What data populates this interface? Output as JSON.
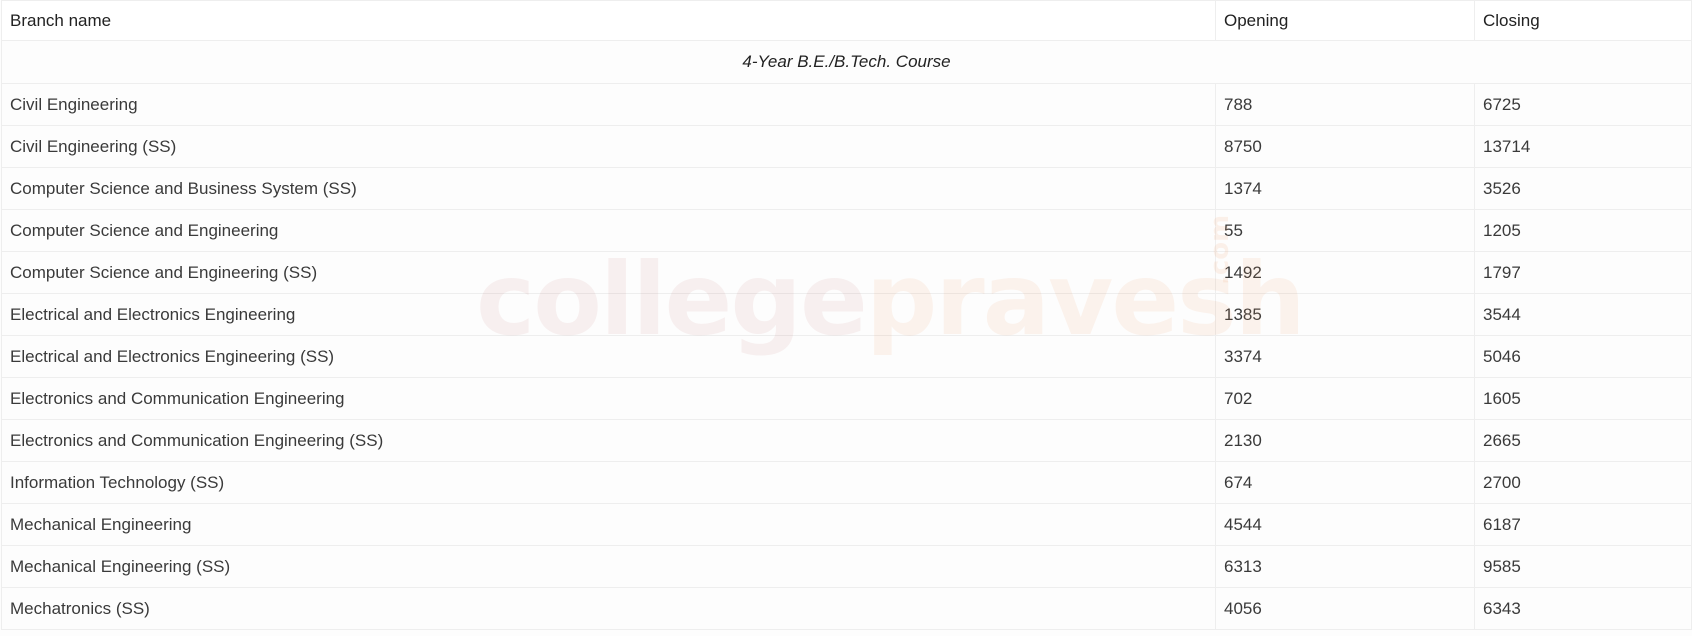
{
  "table": {
    "headers": [
      "Branch name",
      "Opening",
      "Closing"
    ],
    "section_label": "4-Year B.E./B.Tech. Course",
    "rows": [
      {
        "branch": "Civil Engineering",
        "opening": "788",
        "closing": "6725"
      },
      {
        "branch": "Civil Engineering (SS)",
        "opening": "8750",
        "closing": "13714"
      },
      {
        "branch": "Computer Science and Business System (SS)",
        "opening": "1374",
        "closing": "3526"
      },
      {
        "branch": "Computer Science and Engineering",
        "opening": "55",
        "closing": "1205"
      },
      {
        "branch": "Computer Science and Engineering (SS)",
        "opening": "1492",
        "closing": "1797"
      },
      {
        "branch": "Electrical and Electronics Engineering",
        "opening": "1385",
        "closing": "3544"
      },
      {
        "branch": "Electrical and Electronics Engineering (SS)",
        "opening": "3374",
        "closing": "5046"
      },
      {
        "branch": "Electronics and Communication Engineering",
        "opening": "702",
        "closing": "1605"
      },
      {
        "branch": "Electronics and Communication Engineering (SS)",
        "opening": "2130",
        "closing": "2665"
      },
      {
        "branch": "Information Technology (SS)",
        "opening": "674",
        "closing": "2700"
      },
      {
        "branch": "Mechanical Engineering",
        "opening": "4544",
        "closing": "6187"
      },
      {
        "branch": "Mechanical Engineering (SS)",
        "opening": "6313",
        "closing": "9585"
      },
      {
        "branch": "Mechatronics (SS)",
        "opening": "4056",
        "closing": "6343"
      }
    ]
  },
  "watermark": {
    "part1": "college",
    "part2": "pravesh",
    "part3": ".com"
  }
}
